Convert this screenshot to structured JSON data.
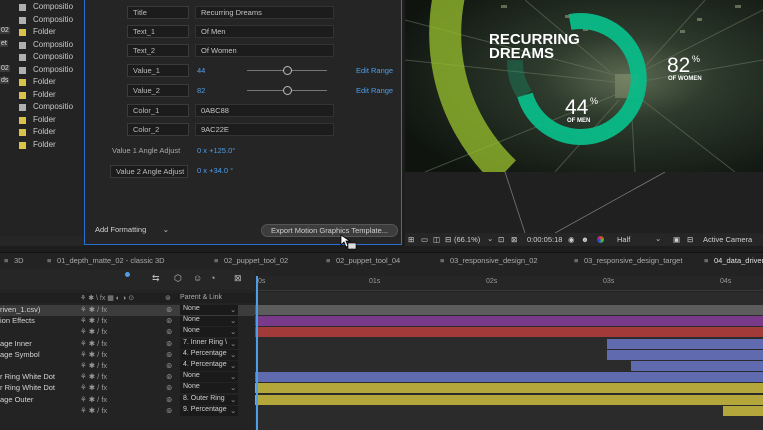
{
  "project": {
    "items": [
      {
        "left": "",
        "name": "Compositio",
        "kind": "comp"
      },
      {
        "left": "",
        "name": "Compositio",
        "kind": "comp"
      },
      {
        "left": "02",
        "name": "Folder",
        "kind": "folder"
      },
      {
        "left": "et",
        "name": "Compositio",
        "kind": "comp"
      },
      {
        "left": "",
        "name": "Compositio",
        "kind": "comp"
      },
      {
        "left": "02",
        "name": "Compositio",
        "kind": "comp"
      },
      {
        "left": "ds",
        "name": "Folder",
        "kind": "folder"
      },
      {
        "left": "",
        "name": "Folder",
        "kind": "folder"
      },
      {
        "left": "",
        "name": "Compositio",
        "kind": "comp"
      },
      {
        "left": "",
        "name": "Folder",
        "kind": "folder"
      },
      {
        "left": "",
        "name": "Folder",
        "kind": "folder"
      },
      {
        "left": "",
        "name": "Folder",
        "kind": "folder"
      }
    ]
  },
  "egp": {
    "rows": [
      {
        "label": "Title",
        "value": "Recurring Dreams"
      },
      {
        "label": "Text_1",
        "value": "Of Men"
      },
      {
        "label": "Text_2",
        "value": "Of Women"
      },
      {
        "label": "Value_1",
        "value": "44",
        "edit": "Edit Range"
      },
      {
        "label": "Value_2",
        "value": "82",
        "edit": "Edit Range"
      },
      {
        "label": "Color_1",
        "value": "0ABC88"
      },
      {
        "label": "Color_2",
        "value": "9AC22E"
      }
    ],
    "angle1_label": "Value 1 Angle Adjust",
    "angle1_value": "0 x +125.0°",
    "angle2_label": "Value 2 Angle Adjust",
    "angle2_value": "0 x +34.0 °",
    "add_formatting": "Add Formatting",
    "export_label": "Export Motion Graphics Template..."
  },
  "viewer": {
    "title_line1": "RECURRING",
    "title_line2": "DREAMS",
    "v2_num": "82",
    "v2_pct": "%",
    "v2_label": "OF WOMEN",
    "v1_num": "44",
    "v1_pct": "%",
    "v1_label": "OF MEN",
    "zoom": "(66.1%)",
    "timecode": "0:00:05:18",
    "quality": "Half",
    "camera": "Active Camera",
    "colors": {
      "ring_outer": "#0ABC88",
      "ring_inner": "#9AC22E"
    }
  },
  "timeline": {
    "tabs": [
      "3D",
      "01_depth_matte_02 - classic 3D",
      "02_puppet_tool_02",
      "02_puppet_tool_04",
      "03_responsive_design_02",
      "03_responsive_design_target",
      "04_data_driven"
    ],
    "active_tab": "04_data_driven",
    "parent_header": "Parent & Link",
    "ruler": [
      "0s",
      "01s",
      "02s",
      "03s",
      "04s"
    ],
    "layers": [
      {
        "name": "riven_1.csv)",
        "parent": "None",
        "bar": "#5c5c5c"
      },
      {
        "name": "ion Effects",
        "parent": "None",
        "bar": "#7a3a8a"
      },
      {
        "name": "",
        "parent": "None",
        "bar": "#a33a3a"
      },
      {
        "name": "age Inner",
        "parent": "7. Inner Ring \\",
        "bar": "#5f6aaf"
      },
      {
        "name": "age Symbol",
        "parent": "4. Percentage",
        "bar": "#5f6aaf"
      },
      {
        "name": "",
        "parent": "4. Percentage",
        "bar": "#5f6aaf"
      },
      {
        "name": "r Ring White Dot",
        "parent": "None",
        "bar": "#5f6aaf"
      },
      {
        "name": "r Ring White Dot",
        "parent": "None",
        "bar": "#b3a63a"
      },
      {
        "name": "age Outer",
        "parent": "8. Outer Ring",
        "bar": "#b3a63a"
      },
      {
        "name": "",
        "parent": "9. Percentage",
        "bar": "#b3a63a"
      }
    ]
  }
}
